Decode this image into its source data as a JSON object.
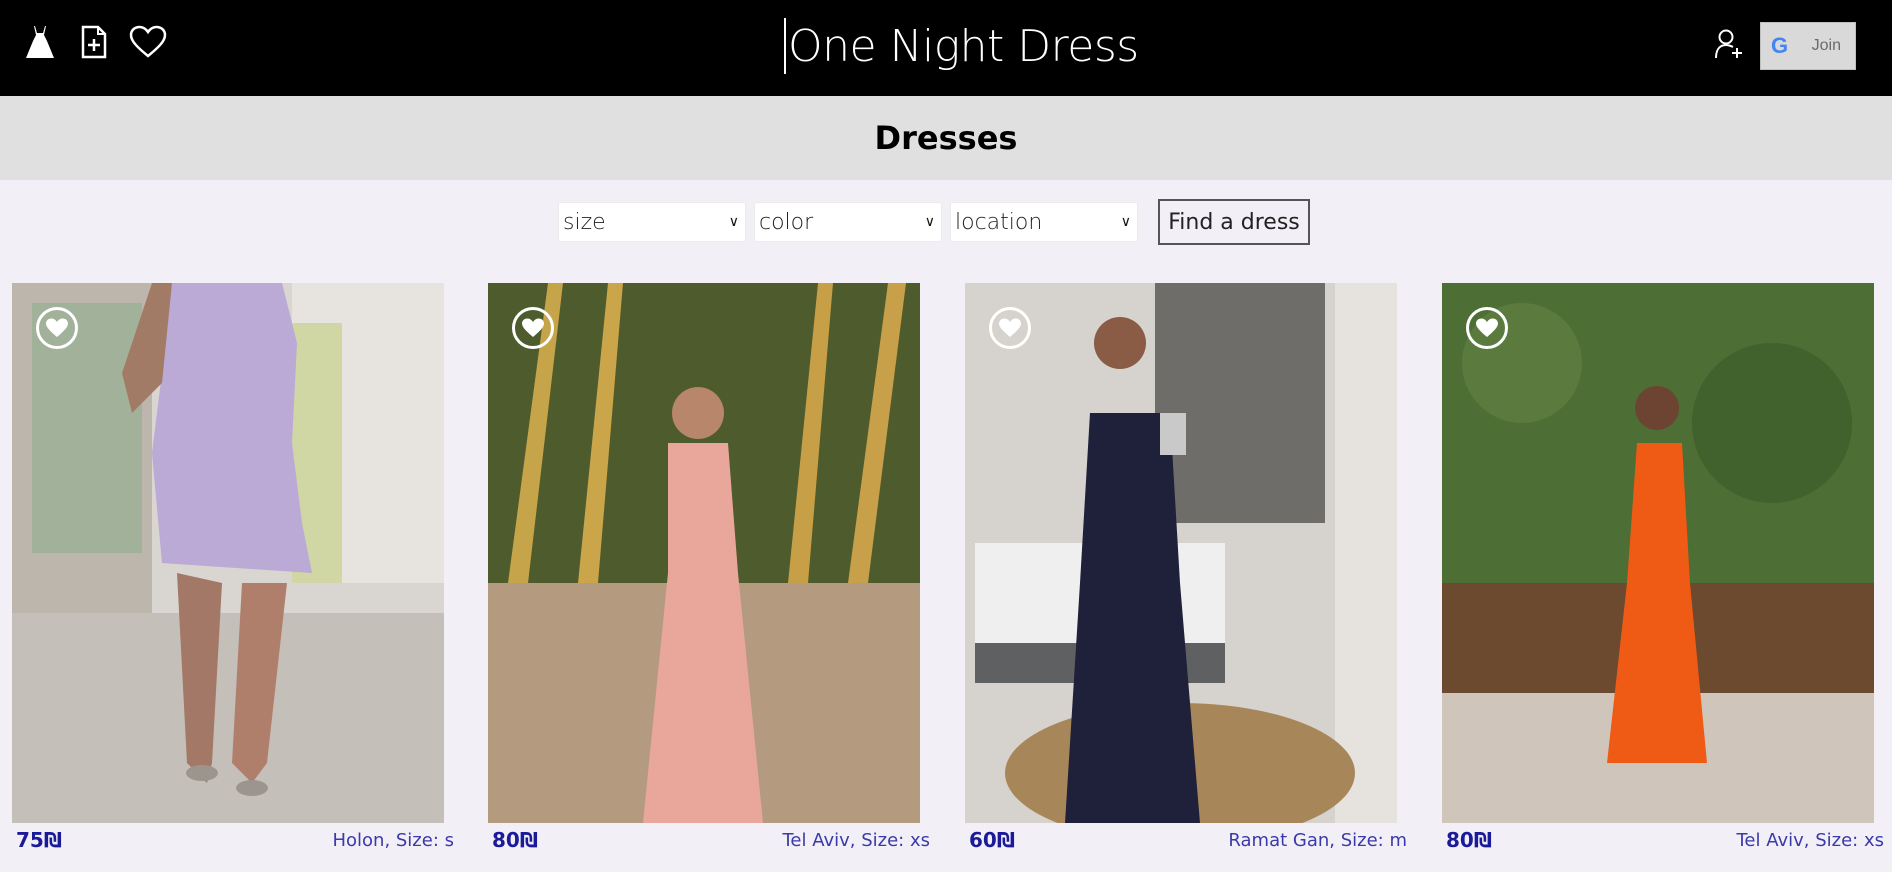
{
  "header": {
    "title": "One Night Dress",
    "icons": [
      "dress-icon",
      "add-document-icon",
      "heart-icon"
    ],
    "join_label": "Join",
    "google_glyph": "G"
  },
  "section": {
    "title": "Dresses"
  },
  "filters": {
    "size": {
      "value": "size"
    },
    "color": {
      "value": "color"
    },
    "location": {
      "value": "location"
    },
    "find_label": "Find a dress"
  },
  "dresses": [
    {
      "price": "75₪",
      "location_text": "Holon, Size: s",
      "dress_color": "#a58bc6",
      "bg": "#cfcac6"
    },
    {
      "price": "80₪",
      "location_text": "Tel Aviv, Size: xs",
      "dress_color": "#e5a39a",
      "bg": "#6d6a3f"
    },
    {
      "price": "60₪",
      "location_text": "Ramat Gan, Size: m",
      "dress_color": "#1f2240",
      "bg": "#d8d4cf"
    },
    {
      "price": "80₪",
      "location_text": "Tel Aviv, Size: xs",
      "dress_color": "#f05a12",
      "bg": "#3c5a2a"
    }
  ]
}
